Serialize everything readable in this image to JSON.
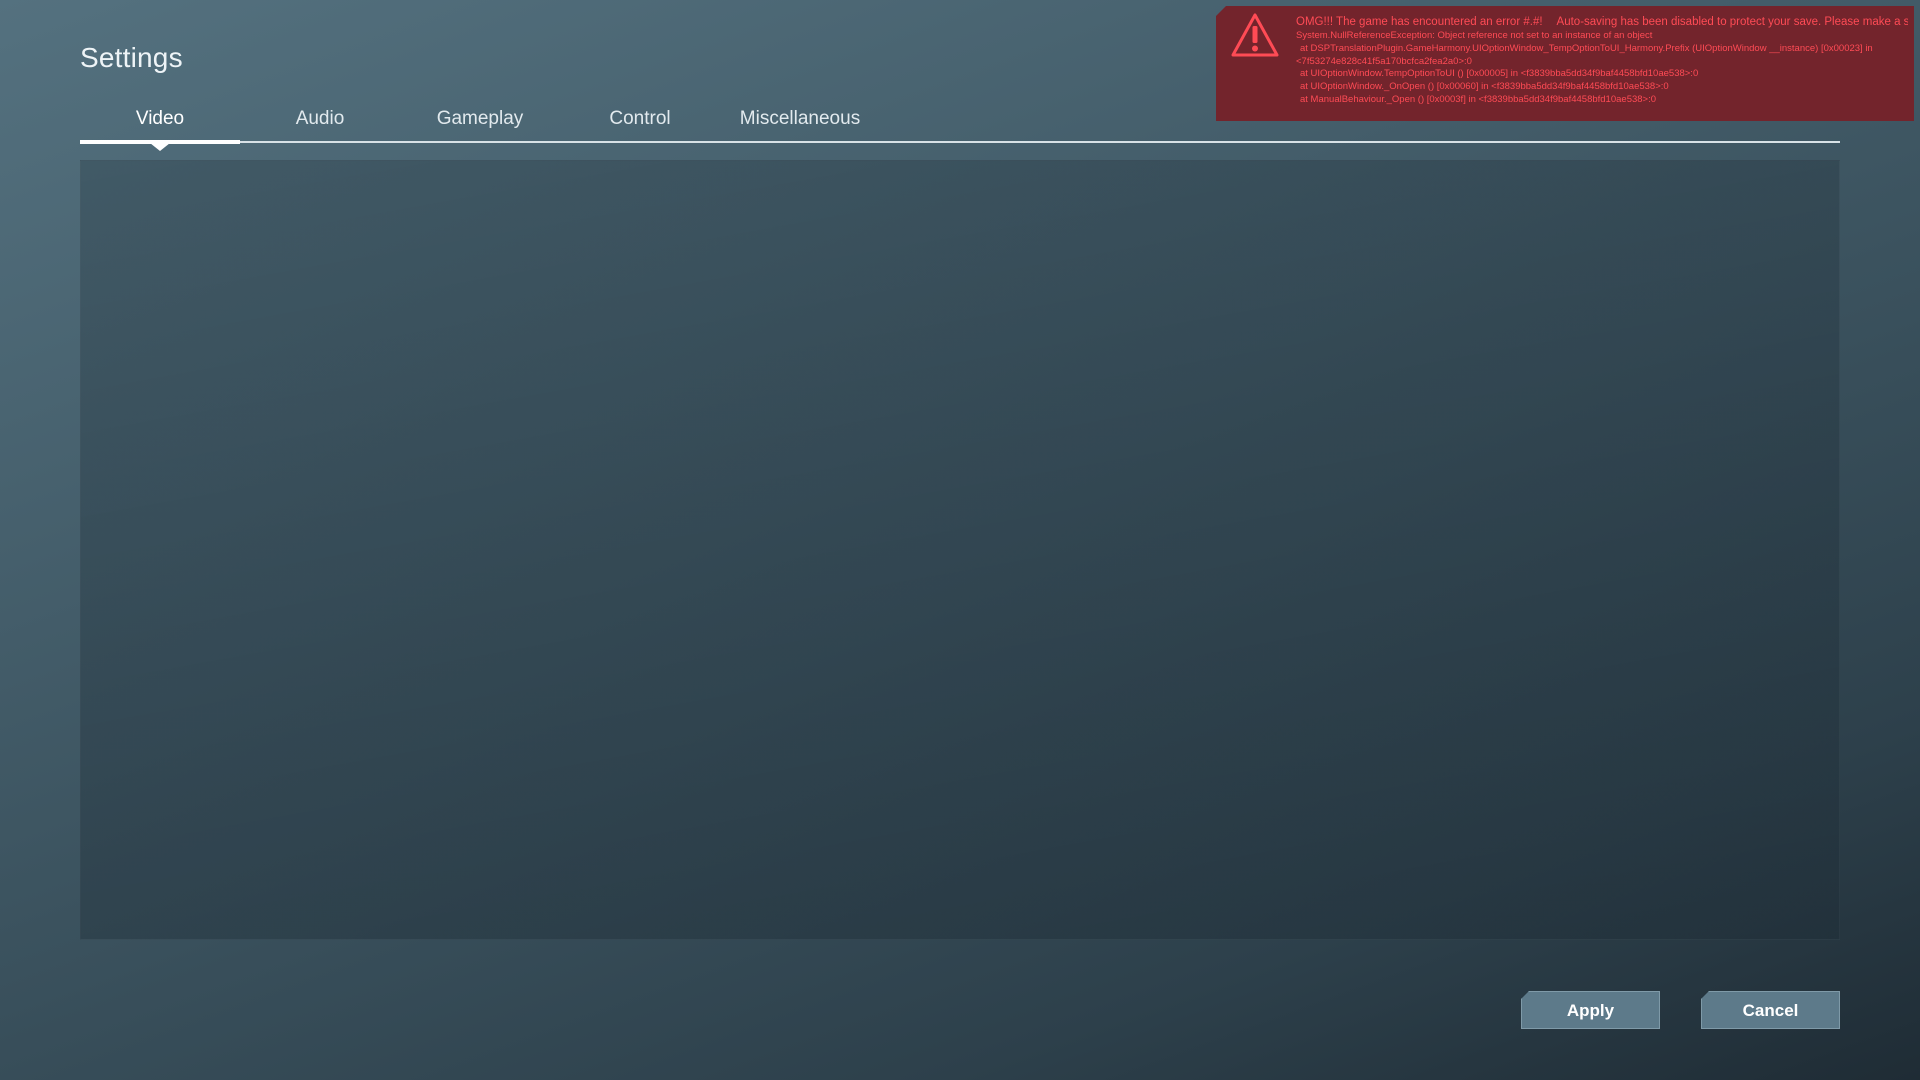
{
  "window": {
    "title": "Settings"
  },
  "tabs": [
    {
      "label": "Video",
      "active": true
    },
    {
      "label": "Audio",
      "active": false
    },
    {
      "label": "Gameplay",
      "active": false
    },
    {
      "label": "Control",
      "active": false
    },
    {
      "label": "Miscellaneous",
      "active": false
    }
  ],
  "footer": {
    "apply_label": "Apply",
    "cancel_label": "Cancel"
  },
  "error": {
    "icon": "warning-triangle-icon",
    "color": "#ff4b55",
    "background": "#73242c",
    "headline": "OMG!!! The game has encountered an error #.#!",
    "autosave_notice": "Auto-saving has been disabled to protect your save. Please make a save",
    "lines": [
      "System.NullReferenceException: Object reference not set to an instance of an object",
      "at DSPTranslationPlugin.GameHarmony.UIOptionWindow_TempOptionToUI_Harmony.Prefix (UIOptionWindow __instance) [0x00023] in",
      "<7f53274e828c41f5a170bcfca2fea2a0>:0",
      "at UIOptionWindow.TempOptionToUI () [0x00005] in <f3839bba5dd34f9baf4458bfd10ae538>:0",
      "at UIOptionWindow._OnOpen () [0x00060] in <f3839bba5dd34f9baf4458bfd10ae538>:0",
      "at ManualBehaviour._Open () [0x0003f] in <f3839bba5dd34f9baf4458bfd10ae538>:0"
    ]
  }
}
